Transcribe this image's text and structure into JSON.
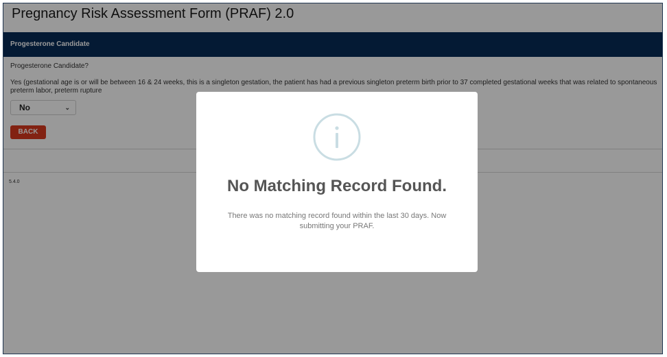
{
  "page": {
    "title": "Pregnancy Risk Assessment Form (PRAF) 2.0",
    "version": "5.4.0"
  },
  "section": {
    "header": "Progesterone Candidate",
    "question": "Progesterone Candidate?",
    "description": "Yes (gestational age is or will be between 16 & 24 weeks, this is a singleton gestation, the patient has had a previous singleton preterm birth prior to 37 completed gestational weeks that was related to spontaneous preterm labor, preterm rupture",
    "select_value": "No",
    "back_label": "BACK"
  },
  "modal": {
    "icon": "info-icon",
    "title": "No Matching Record Found.",
    "message": "There was no matching record found within the last 30 days. Now submitting your PRAF."
  },
  "colors": {
    "header_bg": "#082c57",
    "back_button": "#d93a1f",
    "icon_ring": "#c9dde3"
  }
}
